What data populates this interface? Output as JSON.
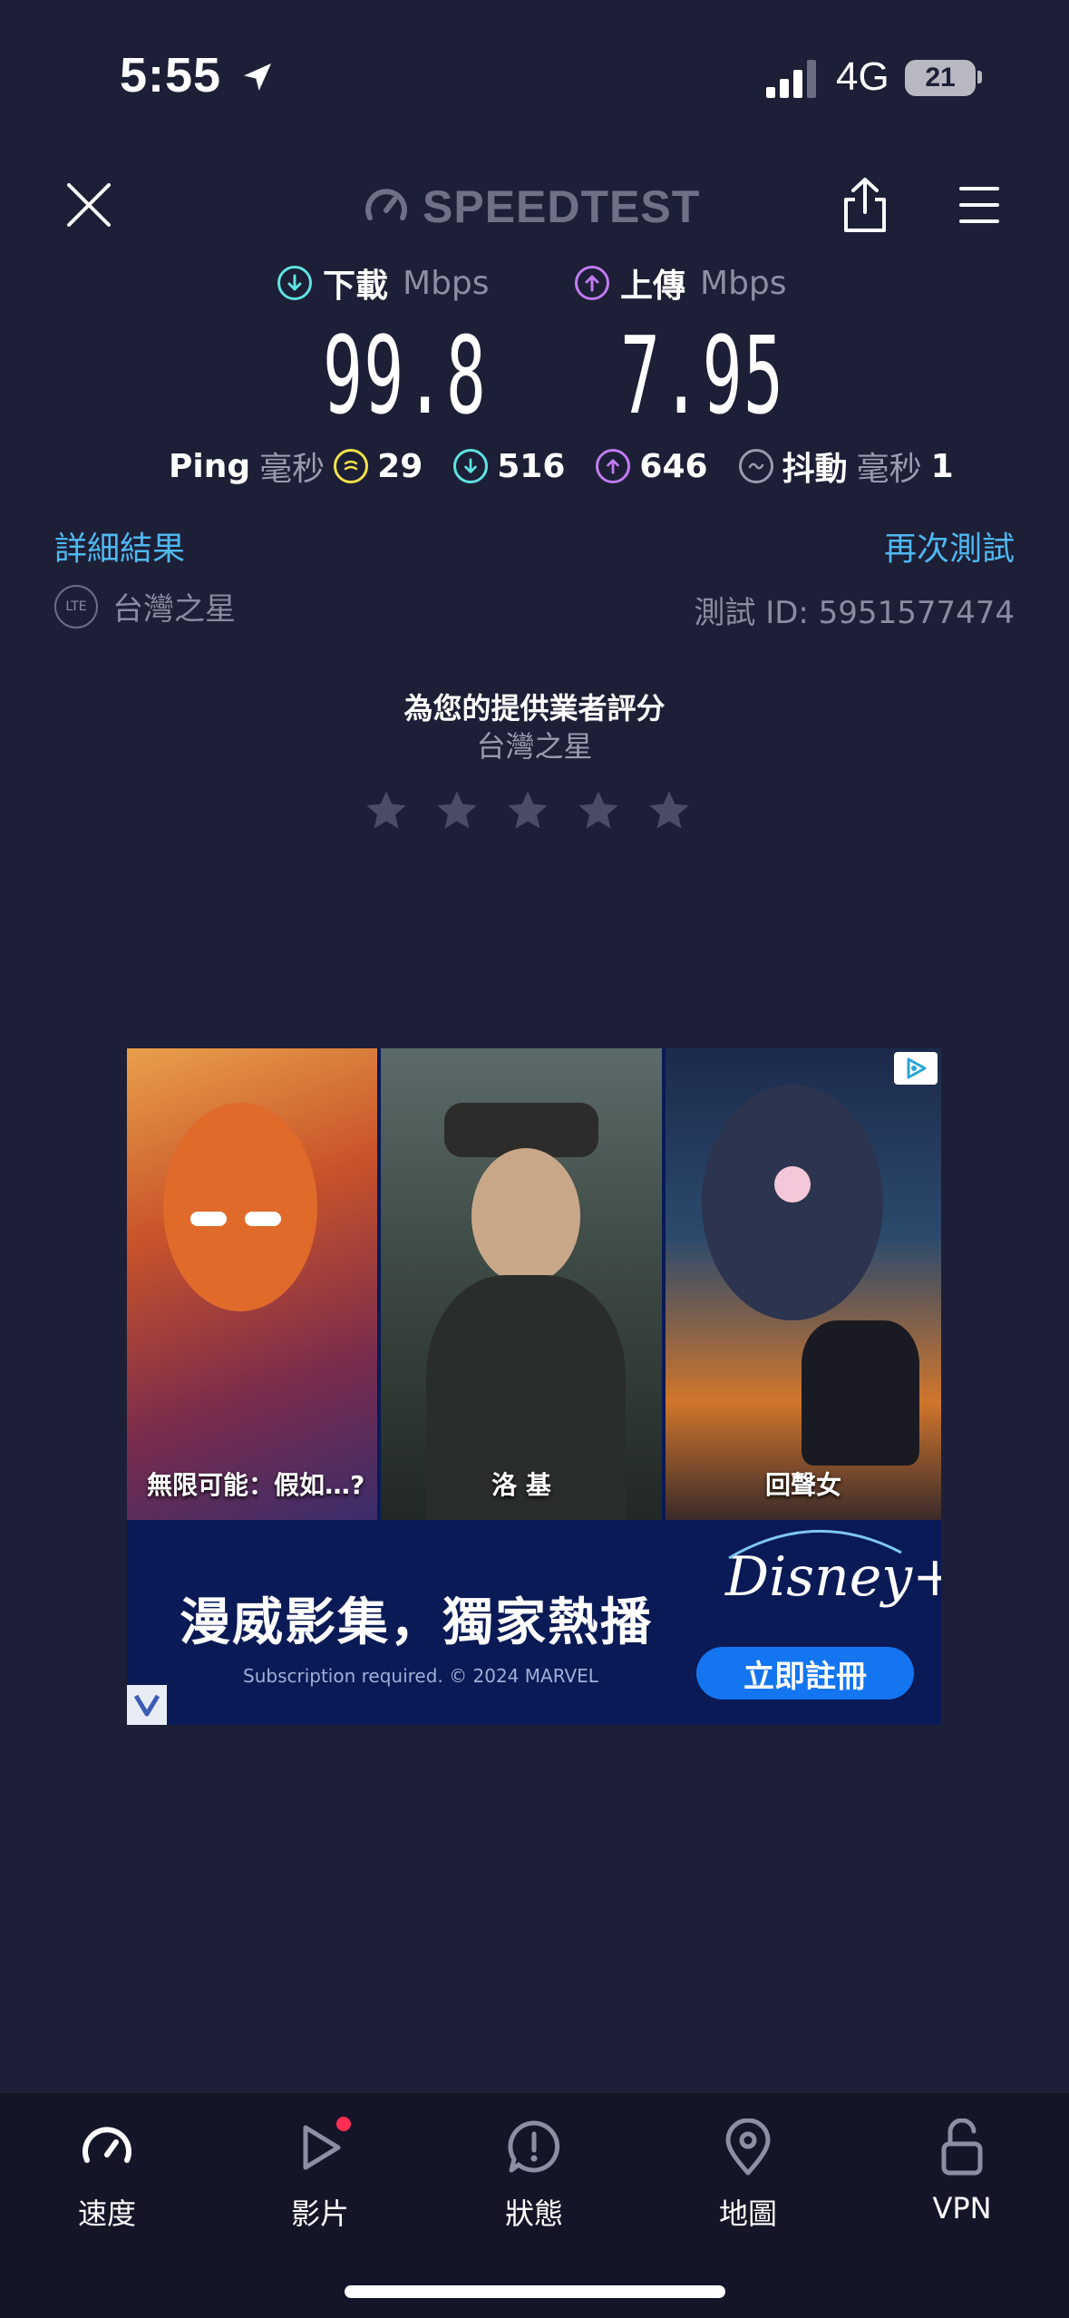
{
  "status_bar": {
    "time": "5:55",
    "network": "4G",
    "battery": "21"
  },
  "header": {
    "brand": "SPEEDTEST"
  },
  "download": {
    "label": "下載",
    "unit": "Mbps",
    "value": "99.8"
  },
  "upload": {
    "label": "上傳",
    "unit": "Mbps",
    "value": "7.95"
  },
  "ping": {
    "label": "Ping",
    "unit": "毫秒",
    "idle": "29",
    "download": "516",
    "upload": "646",
    "jitter_label": "抖動",
    "jitter_unit": "毫秒",
    "jitter": "1"
  },
  "links": {
    "details": "詳細結果",
    "retest": "再次測試"
  },
  "carrier": {
    "badge": "LTE",
    "name": "台灣之星",
    "test_id": "測試 ID: 5951577474"
  },
  "rating": {
    "title": "為您的提供業者評分",
    "carrier": "台灣之星",
    "stars": 5,
    "selected": 0
  },
  "ad": {
    "posters": [
      "無限可能：假如…?",
      "洛 基",
      "回聲女"
    ],
    "slogan": "漫威影集，獨家熱播",
    "fine_print": "Subscription required. © 2024 MARVEL",
    "brand": "Disney+",
    "cta": "立即註冊"
  },
  "tabs": [
    {
      "label": "速度",
      "icon": "speedometer-icon",
      "active": true
    },
    {
      "label": "影片",
      "icon": "play-icon",
      "badge": true
    },
    {
      "label": "狀態",
      "icon": "alert-bubble-icon"
    },
    {
      "label": "地圖",
      "icon": "map-pin-icon"
    },
    {
      "label": "VPN",
      "icon": "lock-open-icon"
    }
  ],
  "colors": {
    "background": "#1d1f36",
    "download": "#5ee3e3",
    "upload": "#c07cf0",
    "ping": "#f2e24a",
    "link": "#4fb8f0"
  }
}
